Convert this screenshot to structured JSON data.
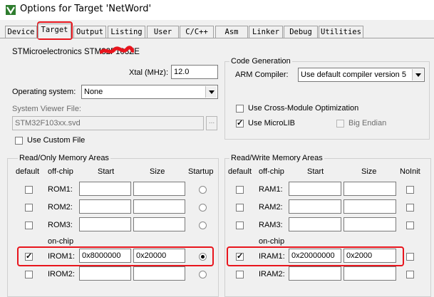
{
  "window": {
    "title": "Options for Target 'NetWord'"
  },
  "tabs": [
    {
      "label": "Device"
    },
    {
      "label": "Target"
    },
    {
      "label": "Output"
    },
    {
      "label": "Listing"
    },
    {
      "label": "User"
    },
    {
      "label": "C/C++"
    },
    {
      "label": "Asm"
    },
    {
      "label": "Linker"
    },
    {
      "label": "Debug"
    },
    {
      "label": "Utilities"
    }
  ],
  "device": {
    "name": "STMicroelectronics STM32F103ZE"
  },
  "xtal": {
    "label": "Xtal (MHz):",
    "value": "12.0"
  },
  "os": {
    "label": "Operating system:",
    "value": "None"
  },
  "svd": {
    "label": "System Viewer File:",
    "value": "STM32F103xx.svd",
    "use_custom_label": "Use Custom File"
  },
  "codegen": {
    "title": "Code Generation",
    "compiler_label": "ARM Compiler:",
    "compiler_value": "Use default compiler version 5",
    "cross_module_label": "Use Cross-Module Optimization",
    "microlib_label": "Use MicroLIB",
    "big_endian_label": "Big Endian"
  },
  "ro": {
    "title": "Read/Only Memory Areas",
    "headers": {
      "default": "default",
      "offchip": "off-chip",
      "start": "Start",
      "size": "Size",
      "startup": "Startup"
    },
    "onchip_label": "on-chip",
    "rows": [
      {
        "name": "ROM1:",
        "start": "",
        "size": ""
      },
      {
        "name": "ROM2:",
        "start": "",
        "size": ""
      },
      {
        "name": "ROM3:",
        "start": "",
        "size": ""
      },
      {
        "name": "IROM1:",
        "start": "0x8000000",
        "size": "0x20000"
      },
      {
        "name": "IROM2:",
        "start": "",
        "size": ""
      }
    ]
  },
  "rw": {
    "title": "Read/Write Memory Areas",
    "headers": {
      "default": "default",
      "offchip": "off-chip",
      "start": "Start",
      "size": "Size",
      "noinit": "NoInit"
    },
    "onchip_label": "on-chip",
    "rows": [
      {
        "name": "RAM1:",
        "start": "",
        "size": ""
      },
      {
        "name": "RAM2:",
        "start": "",
        "size": ""
      },
      {
        "name": "RAM3:",
        "start": "",
        "size": ""
      },
      {
        "name": "IRAM1:",
        "start": "0x20000000",
        "size": "0x2000"
      },
      {
        "name": "IRAM2:",
        "start": "",
        "size": ""
      }
    ]
  },
  "colors": {
    "annotation_red": "#e8151d",
    "background": "#f0f0f0"
  },
  "icons": {
    "app": "keil-uvision-icon"
  }
}
